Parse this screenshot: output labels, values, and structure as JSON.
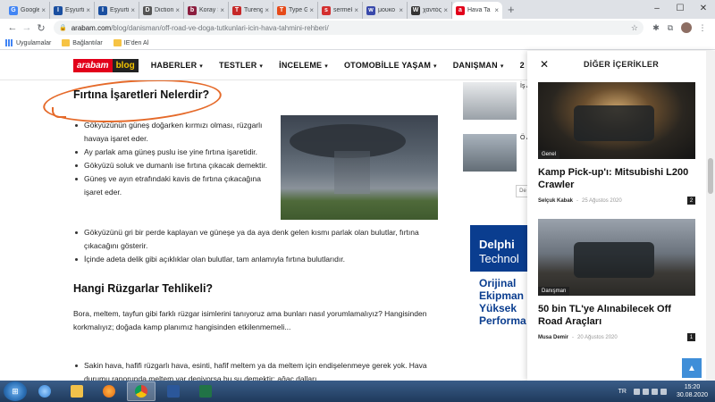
{
  "browser": {
    "tabs": [
      {
        "label": "Google",
        "icon": "google-icon",
        "color": "#4285f4",
        "glyph": "G"
      },
      {
        "label": "Eşyurtio",
        "icon": "dictionary-icon",
        "color": "#1a4fa0",
        "glyph": "I"
      },
      {
        "label": "Eşyurtio",
        "icon": "dictionary-icon",
        "color": "#1a4fa0",
        "glyph": "I"
      },
      {
        "label": "Diction",
        "icon": "dictionary-icon",
        "color": "#555555",
        "glyph": "D"
      },
      {
        "label": "Koray Ş",
        "icon": "bookmark-icon",
        "color": "#8b1e3f",
        "glyph": "b"
      },
      {
        "label": "Tureng",
        "icon": "tureng-icon",
        "color": "#c62828",
        "glyph": "T"
      },
      {
        "label": "Type Gr",
        "icon": "type-icon",
        "color": "#e64a19",
        "glyph": "T"
      },
      {
        "label": "sermek",
        "icon": "sermek-icon",
        "color": "#d32f2f",
        "glyph": "s"
      },
      {
        "label": "μουκο",
        "icon": "wiktionary-icon",
        "color": "#3949ab",
        "glyph": "w"
      },
      {
        "label": "χαντός",
        "icon": "wikipedia-icon",
        "color": "#333333",
        "glyph": "W"
      },
      {
        "label": "Hava Ta",
        "icon": "arabam-icon",
        "color": "#e2001a",
        "glyph": "a"
      }
    ],
    "window_controls": {
      "minimize": "–",
      "maximize": "☐",
      "close": "✕"
    },
    "url_host": "arabam.com",
    "url_path": "/blog/danisman/off-road-ve-doga-tutkunlari-icin-hava-tahmini-rehberi/",
    "bookmarks": [
      "Uygulamalar",
      "Bağlantılar",
      "IE'den Al"
    ]
  },
  "site": {
    "logo_part1": "arabam",
    "logo_part2": "blog",
    "menu": [
      "HABERLER",
      "TESTLER",
      "İNCELEME",
      "OTOMOBİLLE YAŞAM",
      "DANIŞMAN",
      "2"
    ],
    "brand_color": "#e2001a"
  },
  "article": {
    "heading1": "Fırtına İşaretleri Nelerdir?",
    "bullets1": [
      "Gökyüzünün güneş doğarken kırmızı olması, rüzgarlı havaya işaret eder.",
      "Ay parlak ama güneş puslu ise yine fırtına işaretidir.",
      "Gökyüzü soluk ve dumanlı ise fırtına çıkacak demektir.",
      "Güneş ve ayın etrafındaki kavis de fırtına çıkacağına işaret eder."
    ],
    "bullets2": [
      "Gökyüzünü gri bir perde kaplayan ve güneşe ya da aya denk gelen kısmı parlak olan bulutlar, fırtına çıkacağını gösterir.",
      "İçinde adeta delik gibi açıklıklar olan bulutlar, tam anlamıyla fırtına bulutlarıdır."
    ],
    "heading2": "Hangi Rüzgarlar Tehlikeli?",
    "paragraph": "Bora, meltem, tayfun gibi farklı rüzgar isimlerini tanıyoruz ama bunları nasıl yorumlamalıyız? Hangisinden korkmalıyız; doğada kamp planımız hangisinden etkilenmemeli...",
    "bullets3": [
      "Sakin hava, hafifi rüzgarlı hava, esinti, hafif meltem ya da meltem için endişelenmeye gerek yok. Hava durumu raporunda meltem var deniyorsa bu su demektir: ağaç dalları"
    ],
    "annotation_color": "#e56a2a"
  },
  "related": {
    "items": [
      "İş A",
      "Ö A"
    ],
    "button": "De"
  },
  "ad": {
    "line1": "Delphi",
    "line2": "Technol",
    "line3": "Orijinal",
    "line4": "Ekipman",
    "line5": "Yüksek",
    "line6": "Performa"
  },
  "panel": {
    "title": "DİĞER İÇERİKLER",
    "close": "✕",
    "cards": [
      {
        "category": "Genel",
        "title": "Kamp Pick-up'ı: Mitsubishi L200 Crawler",
        "author": "Selçuk Kabak",
        "date": "25 Ağustos 2020",
        "count": "2"
      },
      {
        "category": "Danışman",
        "title": "50 bin TL'ye Alınabilecek Off Road Araçları",
        "author": "Musa Demir",
        "date": "20 Ağustos 2020",
        "count": "1"
      }
    ],
    "to_top": "▲"
  },
  "taskbar": {
    "language": "TR",
    "time": "15:20",
    "date": "30.08.2020"
  }
}
